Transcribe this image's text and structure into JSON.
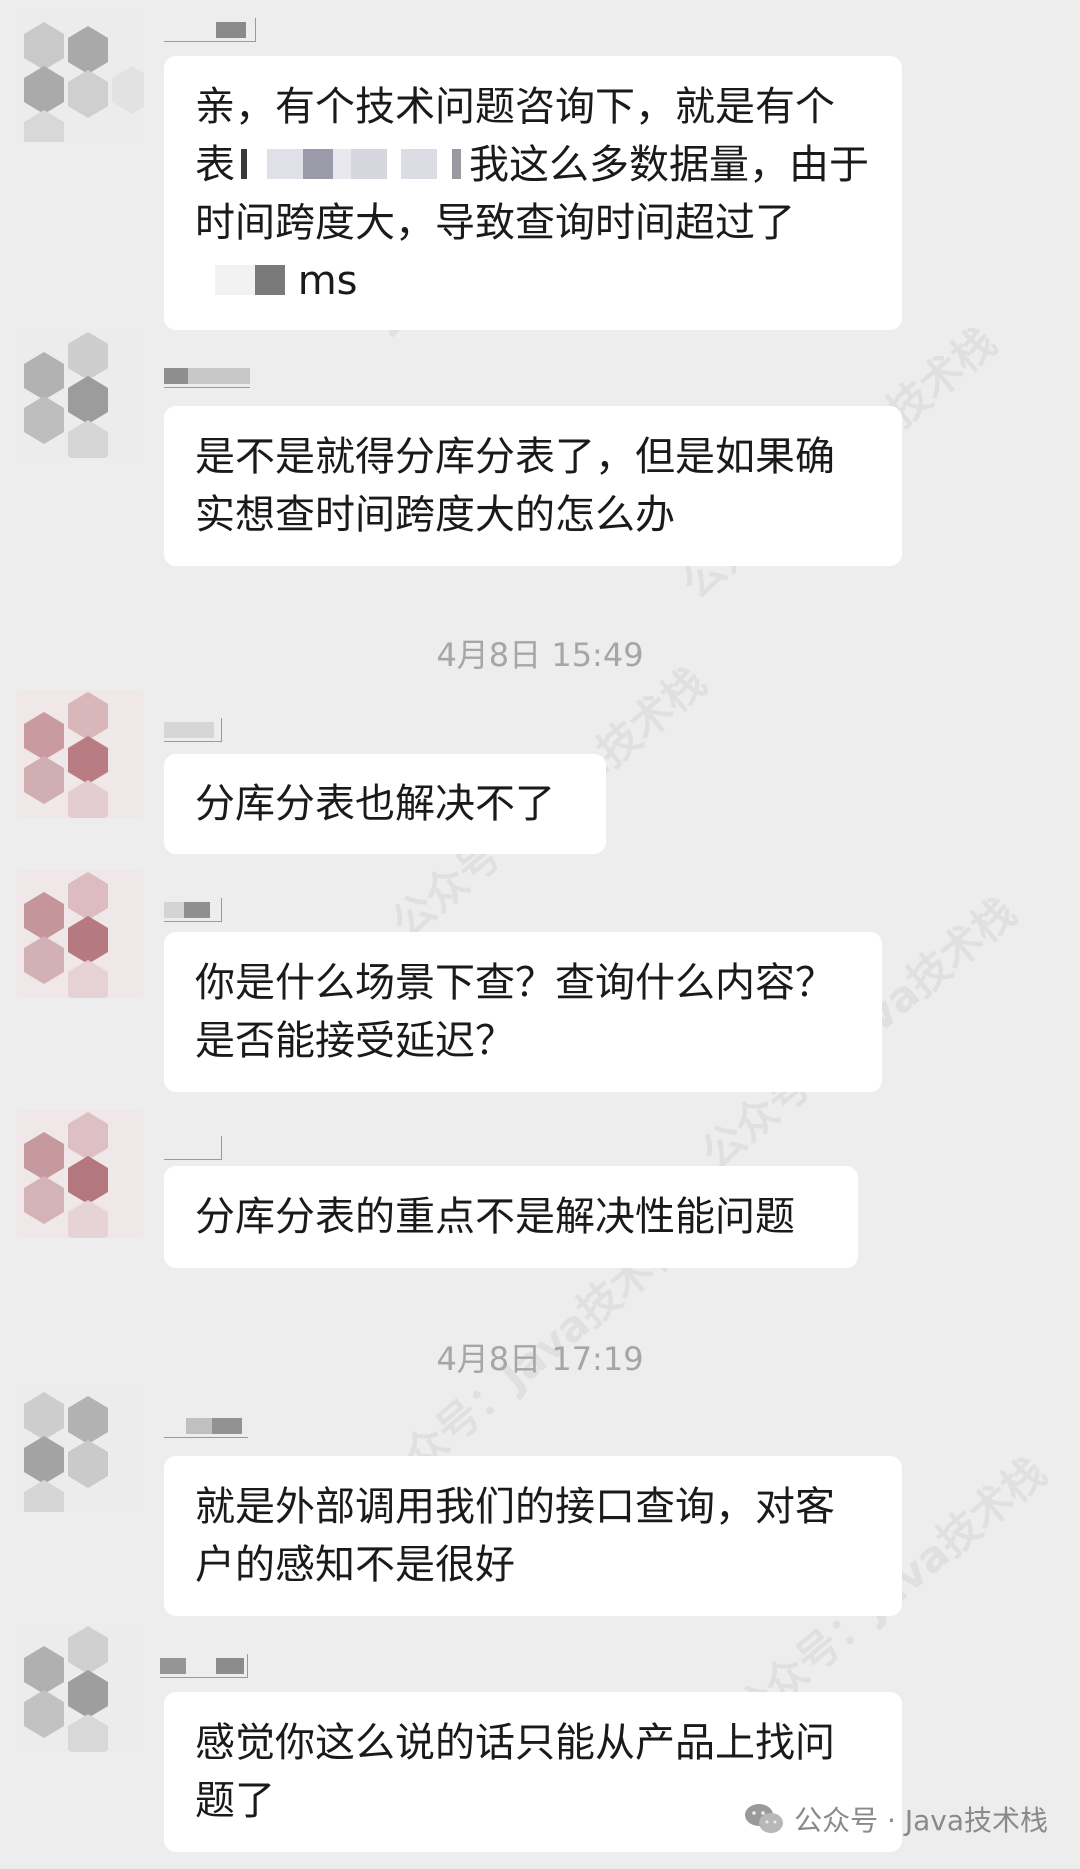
{
  "messages": [
    {
      "lines": [
        "亲，有个技术问题咨询下，就是有个",
        "表",
        "我这么多数据量，由于",
        "时间跨度大，导致查询时间超过了",
        "ms"
      ]
    },
    {
      "lines": [
        "是不是就得分库分表了，但是如果确",
        "实想查时间跨度大的怎么办"
      ]
    },
    {
      "lines": [
        "分库分表也解决不了"
      ]
    },
    {
      "lines": [
        "你是什么场景下查？查询什么内容？",
        "是否能接受延迟？"
      ]
    },
    {
      "lines": [
        "分库分表的重点不是解决性能问题"
      ]
    },
    {
      "lines": [
        "就是外部调用我们的接口查询，对客",
        "户的感知不是很好"
      ]
    },
    {
      "lines": [
        "感觉你这么说的话只能从产品上找问",
        "题了"
      ]
    }
  ],
  "timestamps": [
    "4月8日 15:49",
    "4月8日 17:19"
  ],
  "watermark": {
    "account": "公众号：",
    "name": "Java技术栈"
  },
  "footer": {
    "text": "公众号 · Java技术栈",
    "icon": "wechat-icon"
  }
}
